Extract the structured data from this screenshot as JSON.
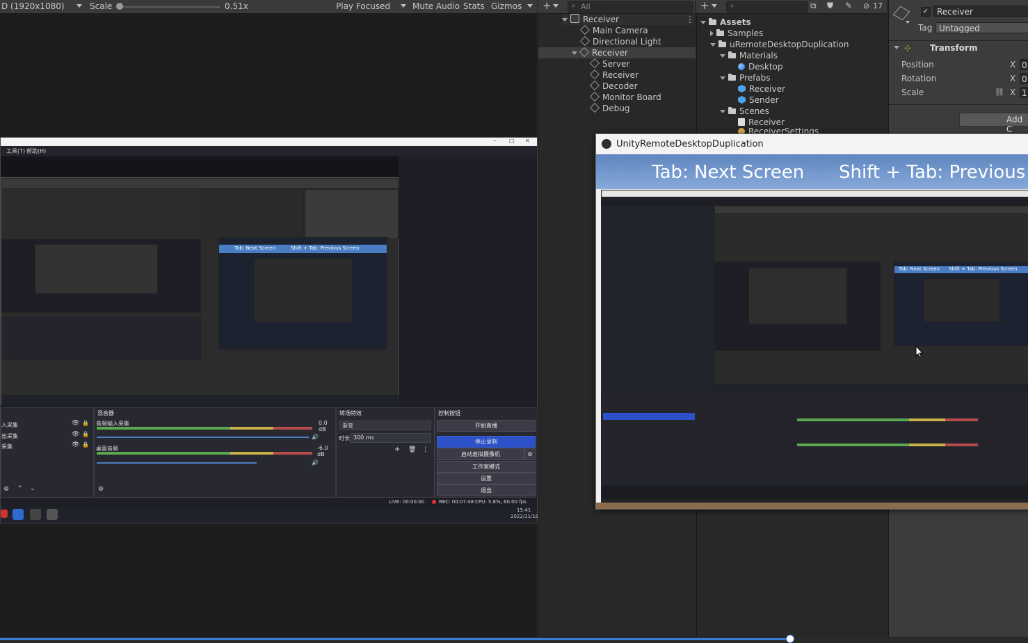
{
  "game_toolbar": {
    "resolution": "D (1920x1080)",
    "scale_label": "Scale",
    "scale_value": "0.51x",
    "play_focused": "Play Focused",
    "mute_audio": "Mute Audio",
    "stats": "Stats",
    "gizmos": "Gizmos"
  },
  "obs": {
    "menu_items": [
      "工具(T)",
      "帮助(H)"
    ],
    "docks": {
      "mixer_title": "混音器",
      "transitions_title": "转场特效",
      "controls_title": "控制按钮",
      "mixer_tracks": [
        {
          "name": "音频输入采集",
          "level": "0.0 dB"
        },
        {
          "name": "桌面音频",
          "level": "-6.0 dB"
        }
      ],
      "sources_left": [
        "入采集",
        "出采集",
        "采集"
      ],
      "transition_value": "渐变",
      "duration_label": "时长",
      "duration_value": "300 ms",
      "buttons": [
        "开始直播",
        "停止录制",
        "启动虚拟摄像机",
        "工作室模式",
        "设置",
        "退出"
      ]
    },
    "status": {
      "live": "LIVE: 00:00:00",
      "rec": "REC: 00:07:48",
      "cpu": "CPU: 5.8%, 60.00 fps"
    },
    "clock_time": "15:41",
    "clock_date": "2022/11/18"
  },
  "hierarchy": {
    "search_placeholder": "All",
    "scene": "Receiver",
    "items": [
      {
        "label": "Main Camera",
        "depth": 1
      },
      {
        "label": "Directional Light",
        "depth": 1
      },
      {
        "label": "Receiver",
        "depth": 1,
        "selected": true,
        "expanded": true
      },
      {
        "label": "Server",
        "depth": 2
      },
      {
        "label": "Receiver",
        "depth": 2
      },
      {
        "label": "Decoder",
        "depth": 2
      },
      {
        "label": "Monitor Board",
        "depth": 2
      },
      {
        "label": "Debug",
        "depth": 2
      }
    ]
  },
  "project": {
    "hidden_count": "17",
    "items": [
      {
        "label": "Assets",
        "depth": 0,
        "kind": "folder",
        "bold": true
      },
      {
        "label": "Samples",
        "depth": 1,
        "kind": "folder"
      },
      {
        "label": "uRemoteDesktopDuplication",
        "depth": 1,
        "kind": "folder"
      },
      {
        "label": "Materials",
        "depth": 2,
        "kind": "folder"
      },
      {
        "label": "Desktop",
        "depth": 3,
        "kind": "material"
      },
      {
        "label": "Prefabs",
        "depth": 2,
        "kind": "folder"
      },
      {
        "label": "Receiver",
        "depth": 3,
        "kind": "prefab"
      },
      {
        "label": "Sender",
        "depth": 3,
        "kind": "prefab"
      },
      {
        "label": "Scenes",
        "depth": 2,
        "kind": "folder"
      },
      {
        "label": "Receiver",
        "depth": 3,
        "kind": "scene"
      },
      {
        "label": "ReceiverSettings",
        "depth": 3,
        "kind": "settings"
      }
    ]
  },
  "inspector": {
    "object_name": "Receiver",
    "tag_label": "Tag",
    "tag_value": "Untagged",
    "component_title": "Transform",
    "rows": [
      {
        "label": "Position",
        "axis": "X",
        "value": "0"
      },
      {
        "label": "Rotation",
        "axis": "X",
        "value": "0"
      },
      {
        "label": "Scale",
        "axis": "X",
        "value": "1"
      }
    ],
    "add_component": "Add C"
  },
  "remote": {
    "title": "UnityRemoteDesktopDuplication",
    "hint_next": "Tab: Next Screen",
    "hint_prev": "Shift + Tab: Previous",
    "nested_hint_next": "Tab: Next Screen",
    "nested_hint_prev": "Shift + Tab: Previous Screen"
  },
  "colors": {
    "accent_blue": "#3a7bd5",
    "obs_active_button": "#2d51c8",
    "hint_bar": "#6f93c9"
  }
}
